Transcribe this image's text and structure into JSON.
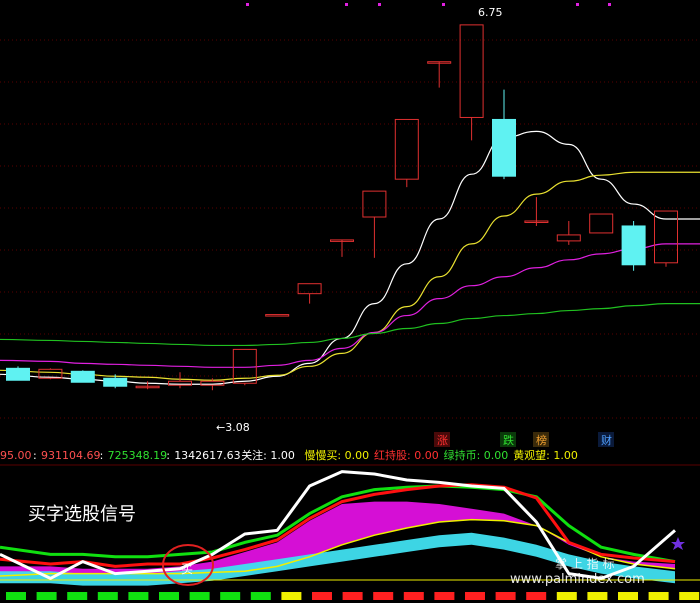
{
  "colors": {
    "background": "#000000",
    "grid": "#5a0000",
    "up_candle": "#e03030",
    "down_candle": "#5ff2f2",
    "ma_white": "#ffffff",
    "ma_yellow": "#e8e030",
    "ma_magenta": "#e020e0",
    "ma_green": "#20c020",
    "tick_marker": "#e020e0",
    "signal_green": "#10e010",
    "signal_red": "#ff2020",
    "signal_yellow": "#f0f000"
  },
  "chart_data": [
    {
      "type": "candlestick",
      "ylim": [
        2.6,
        7.0
      ],
      "annotations": {
        "high_label": "6.75",
        "low_label": "←3.08"
      },
      "candles": [
        {
          "o": 3.3,
          "h": 3.32,
          "l": 3.18,
          "c": 3.18
        },
        {
          "o": 3.2,
          "h": 3.3,
          "l": 3.19,
          "c": 3.29
        },
        {
          "o": 3.27,
          "h": 3.28,
          "l": 3.16,
          "c": 3.16
        },
        {
          "o": 3.2,
          "h": 3.24,
          "l": 3.1,
          "c": 3.12
        },
        {
          "o": 3.12,
          "h": 3.17,
          "l": 3.09,
          "c": 3.12
        },
        {
          "o": 3.13,
          "h": 3.26,
          "l": 3.1,
          "c": 3.17
        },
        {
          "o": 3.13,
          "h": 3.2,
          "l": 3.08,
          "c": 3.17
        },
        {
          "o": 3.15,
          "h": 3.49,
          "l": 3.13,
          "c": 3.49
        },
        {
          "o": 3.84,
          "h": 3.84,
          "l": 3.84,
          "c": 3.84
        },
        {
          "o": 4.05,
          "h": 4.15,
          "l": 3.95,
          "c": 4.15
        },
        {
          "o": 4.59,
          "h": 4.59,
          "l": 4.42,
          "c": 4.59
        },
        {
          "o": 4.82,
          "h": 5.08,
          "l": 4.41,
          "c": 5.08
        },
        {
          "o": 5.2,
          "h": 5.8,
          "l": 5.12,
          "c": 5.8
        },
        {
          "o": 6.38,
          "h": 6.38,
          "l": 6.12,
          "c": 6.38
        },
        {
          "o": 5.82,
          "h": 6.75,
          "l": 5.59,
          "c": 6.75
        },
        {
          "o": 5.8,
          "h": 6.1,
          "l": 5.2,
          "c": 5.23
        },
        {
          "o": 4.78,
          "h": 5.02,
          "l": 4.73,
          "c": 4.78
        },
        {
          "o": 4.58,
          "h": 4.78,
          "l": 4.54,
          "c": 4.64
        },
        {
          "o": 4.66,
          "h": 4.85,
          "l": 4.66,
          "c": 4.85
        },
        {
          "o": 4.73,
          "h": 4.78,
          "l": 4.28,
          "c": 4.34
        },
        {
          "o": 4.36,
          "h": 4.88,
          "l": 4.32,
          "c": 4.88
        }
      ],
      "series": [
        {
          "name": "",
          "color": "white",
          "values": [
            3.24,
            3.21,
            3.19,
            3.17,
            3.15,
            3.14,
            3.14,
            3.17,
            3.22,
            3.35,
            3.6,
            3.95,
            4.35,
            4.8,
            5.25,
            5.62,
            5.68,
            5.55,
            5.2,
            4.95,
            4.8
          ]
        },
        {
          "name": "",
          "color": "yellow",
          "values": [
            3.28,
            3.26,
            3.24,
            3.22,
            3.21,
            3.19,
            3.18,
            3.2,
            3.23,
            3.32,
            3.45,
            3.66,
            3.92,
            4.22,
            4.55,
            4.83,
            5.05,
            5.18,
            5.24,
            5.27,
            5.27
          ]
        },
        {
          "name": "",
          "color": "magenta",
          "values": [
            3.38,
            3.37,
            3.35,
            3.34,
            3.33,
            3.32,
            3.31,
            3.31,
            3.33,
            3.38,
            3.5,
            3.66,
            3.83,
            4.0,
            4.13,
            4.22,
            4.31,
            4.39,
            4.45,
            4.5,
            4.55
          ]
        },
        {
          "name": "",
          "color": "green",
          "values": [
            3.59,
            3.58,
            3.57,
            3.56,
            3.55,
            3.54,
            3.53,
            3.53,
            3.54,
            3.56,
            3.6,
            3.65,
            3.7,
            3.75,
            3.8,
            3.83,
            3.85,
            3.88,
            3.9,
            3.93,
            3.95
          ]
        }
      ],
      "markers": [
        {
          "label": "涨",
          "color": "#ff3030"
        },
        {
          "label": "跌",
          "color": "#30e030"
        },
        {
          "label": "榜",
          "color": "#f0a030"
        },
        {
          "label": "财",
          "color": "#50a0ff"
        }
      ]
    },
    {
      "type": "line",
      "title": "买字选股信号",
      "ylim": [
        0,
        100
      ],
      "series": [
        {
          "name": "",
          "color": "white",
          "values": [
            28,
            8,
            22,
            12,
            14,
            16,
            28,
            45,
            48,
            85,
            97,
            95,
            90,
            88,
            85,
            83,
            55,
            12,
            8,
            18,
            48
          ]
        },
        {
          "name": "",
          "color": "red",
          "values": [
            24,
            20,
            22,
            18,
            20,
            20,
            25,
            32,
            40,
            58,
            72,
            78,
            82,
            85,
            86,
            84,
            75,
            38,
            28,
            25,
            22
          ]
        },
        {
          "name": "",
          "color": "green",
          "values": [
            34,
            28,
            28,
            26,
            26,
            28,
            30,
            38,
            44,
            62,
            76,
            82,
            84,
            85,
            84,
            82,
            76,
            52,
            34,
            28,
            22
          ]
        },
        {
          "name": "",
          "color": "yellow",
          "values": [
            10,
            12,
            12,
            12,
            12,
            12,
            13,
            14,
            18,
            26,
            36,
            44,
            50,
            55,
            57,
            56,
            52,
            38,
            26,
            20,
            16
          ]
        },
        {
          "name": "",
          "color": "cyan",
          "values": [
            14,
            14,
            12,
            12,
            12,
            14,
            16,
            20,
            24,
            28,
            32,
            36,
            40,
            44,
            46,
            42,
            36,
            28,
            22,
            18,
            14
          ]
        },
        {
          "name": "",
          "color": "magenta",
          "values": [
            18,
            18,
            16,
            16,
            16,
            18,
            22,
            30,
            38,
            56,
            70,
            72,
            72,
            70,
            66,
            62,
            52,
            36,
            26,
            22,
            20
          ]
        }
      ],
      "signal": "买",
      "signals": [
        "green",
        "green",
        "green",
        "green",
        "green",
        "green",
        "green",
        "green",
        "green",
        "yellow",
        "red",
        "red",
        "red",
        "red",
        "red",
        "red",
        "red",
        "red",
        "yellow",
        "yellow",
        "yellow",
        "yellow",
        "yellow"
      ]
    }
  ],
  "info_bar": [
    {
      "text": "95.00",
      "color": "#ff5050"
    },
    {
      "text": "931104.69",
      "color": "#ff5050"
    },
    {
      "text": "725348.19",
      "color": "#30e030"
    },
    {
      "text": "1342617.63",
      "color": "#ffffff"
    },
    {
      "text": "关注: 1.00",
      "color": "#ffffff"
    },
    {
      "text": "慢慢买: 0.00",
      "color": "#f0f000"
    },
    {
      "text": "红持股: 0.00",
      "color": "#ff3030"
    },
    {
      "text": "绿持币: 0.00",
      "color": "#30e030"
    },
    {
      "text": "黄观望: 1.00",
      "color": "#f0f000"
    }
  ],
  "watermark": "www.palmindex.com",
  "watermark_cn": "掌 上 指 标"
}
